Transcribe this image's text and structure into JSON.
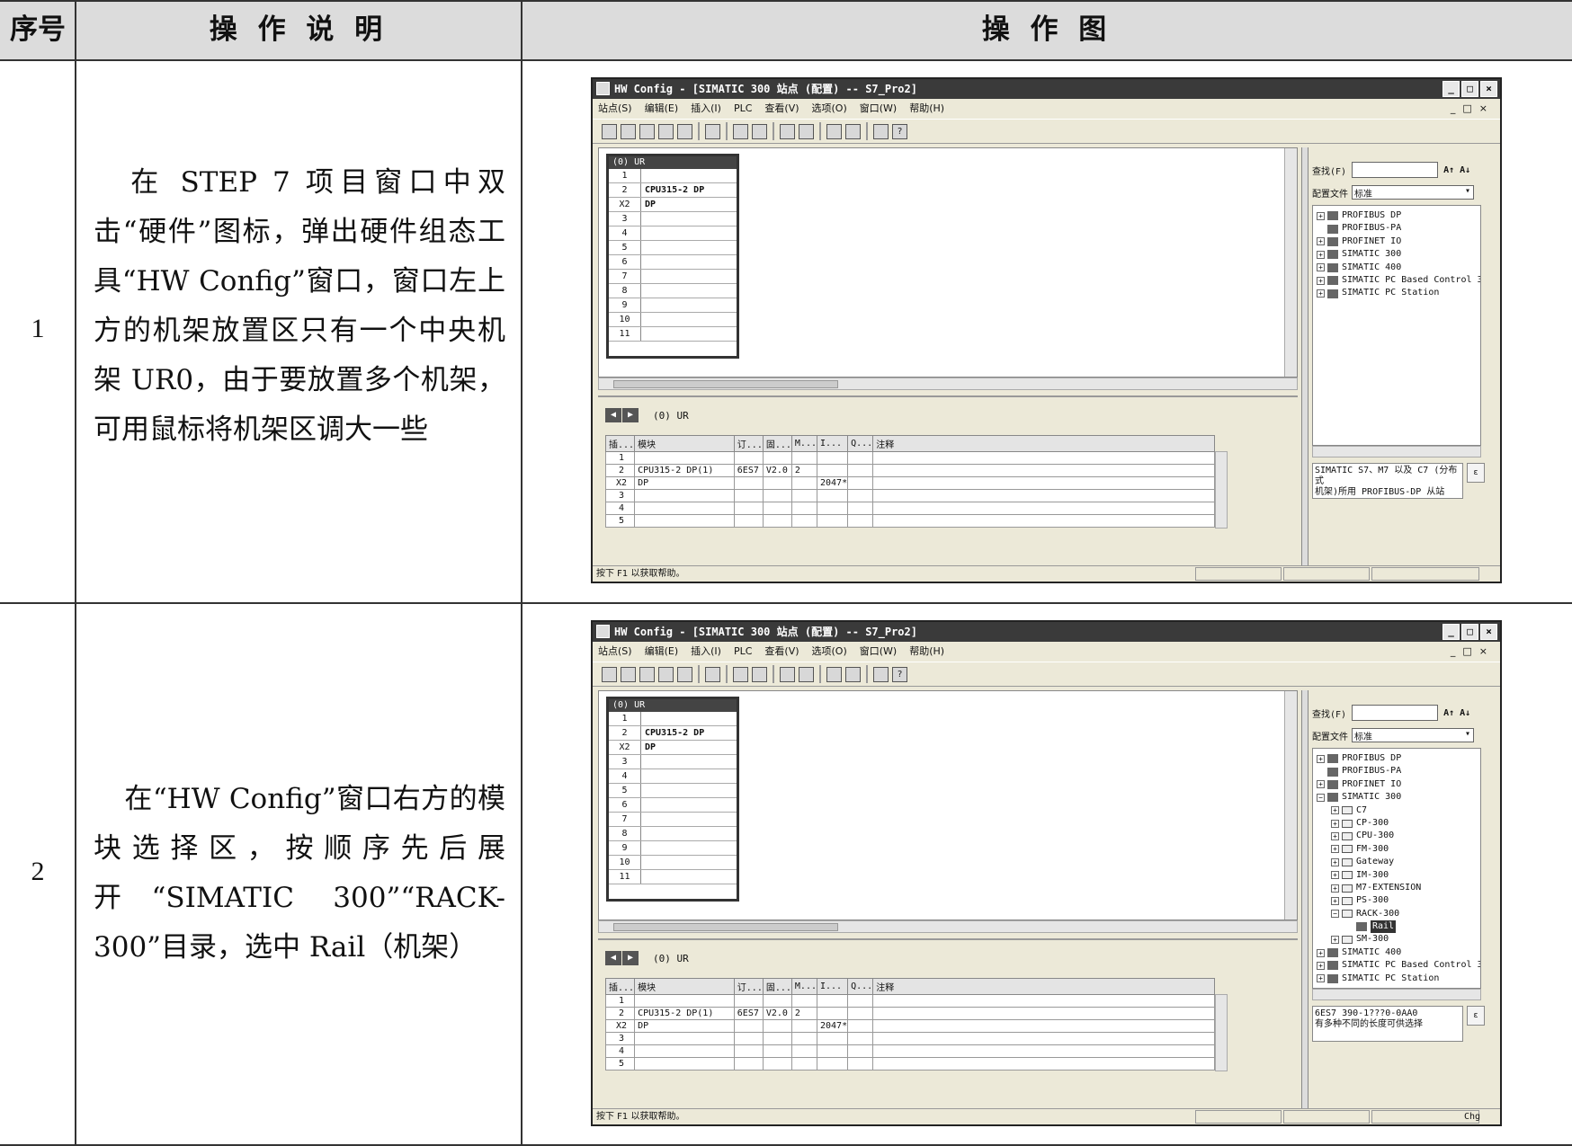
{
  "header": {
    "col_num": "序号",
    "col_desc": "操 作 说 明",
    "col_fig": "操 作 图"
  },
  "rows": [
    {
      "num": "1",
      "desc": "在 STEP 7 项目窗口中双击“硬件”图标，弹出硬件组态工具“HW Config”窗口，窗口左上方的机架放置区只有一个中央机架 UR0，由于要放置多个机架，可用鼠标将机架区调大一些",
      "win": {
        "title": "HW Config - [SIMATIC 300 站点 (配置) -- S7_Pro2]",
        "tree": [
          {
            "label": "PROFIBUS DP",
            "level": 0,
            "exp": "+"
          },
          {
            "label": "PROFIBUS-PA",
            "level": 0,
            "exp": ""
          },
          {
            "label": "PROFINET IO",
            "level": 0,
            "exp": "+"
          },
          {
            "label": "SIMATIC 300",
            "level": 0,
            "exp": "+"
          },
          {
            "label": "SIMATIC 400",
            "level": 0,
            "exp": "+"
          },
          {
            "label": "SIMATIC PC Based Control 300/400",
            "level": 0,
            "exp": "+"
          },
          {
            "label": "SIMATIC PC Station",
            "level": 0,
            "exp": "+"
          }
        ],
        "info": "SIMATIC S7、M7 以及 C7 (分布式\n机架)所用 PROFIBUS-DP 从站",
        "status_chg": ""
      }
    },
    {
      "num": "2",
      "desc": "在“HW Config”窗口右方的模块选择区，按顺序先后展开“SIMATIC 300”“RACK- 300”目录，选中 Rail（机架）",
      "win": {
        "title": "HW Config - [SIMATIC 300 站点 (配置) -- S7_Pro2]",
        "tree": [
          {
            "label": "PROFIBUS DP",
            "level": 0,
            "exp": "+"
          },
          {
            "label": "PROFIBUS-PA",
            "level": 0,
            "exp": ""
          },
          {
            "label": "PROFINET IO",
            "level": 0,
            "exp": "+"
          },
          {
            "label": "SIMATIC 300",
            "level": 0,
            "exp": "−"
          },
          {
            "label": "C7",
            "level": 1,
            "exp": "+"
          },
          {
            "label": "CP-300",
            "level": 1,
            "exp": "+"
          },
          {
            "label": "CPU-300",
            "level": 1,
            "exp": "+"
          },
          {
            "label": "FM-300",
            "level": 1,
            "exp": "+"
          },
          {
            "label": "Gateway",
            "level": 1,
            "exp": "+"
          },
          {
            "label": "IM-300",
            "level": 1,
            "exp": "+"
          },
          {
            "label": "M7-EXTENSION",
            "level": 1,
            "exp": "+"
          },
          {
            "label": "PS-300",
            "level": 1,
            "exp": "+"
          },
          {
            "label": "RACK-300",
            "level": 1,
            "exp": "−"
          },
          {
            "label": "Rail",
            "level": 2,
            "exp": "",
            "selected": true
          },
          {
            "label": "SM-300",
            "level": 1,
            "exp": "+"
          },
          {
            "label": "SIMATIC 400",
            "level": 0,
            "exp": "+"
          },
          {
            "label": "SIMATIC PC Based Control 300/400",
            "level": 0,
            "exp": "+"
          },
          {
            "label": "SIMATIC PC Station",
            "level": 0,
            "exp": "+"
          }
        ],
        "info": "6ES7 390-1???0-0AA0\n有多种不同的长度可供选择",
        "status_chg": "Chg"
      }
    }
  ],
  "hwconfig": {
    "menu": [
      "站点(S)",
      "编辑(E)",
      "插入(I)",
      "PLC",
      "查看(V)",
      "选项(O)",
      "窗口(W)",
      "帮助(H)"
    ],
    "rack_title": "(0) UR",
    "rack_rows": [
      {
        "slot": "1",
        "module": ""
      },
      {
        "slot": "2",
        "module": "CPU315-2 DP"
      },
      {
        "slot": "X2",
        "module": "DP"
      },
      {
        "slot": "3",
        "module": ""
      },
      {
        "slot": "4",
        "module": ""
      },
      {
        "slot": "5",
        "module": ""
      },
      {
        "slot": "6",
        "module": ""
      },
      {
        "slot": "7",
        "module": ""
      },
      {
        "slot": "8",
        "module": ""
      },
      {
        "slot": "9",
        "module": ""
      },
      {
        "slot": "10",
        "module": ""
      },
      {
        "slot": "11",
        "module": ""
      }
    ],
    "detail_label": "(0)   UR",
    "detail_headers": [
      "插...",
      "模块",
      "订...",
      "固...",
      "M...",
      "I...",
      "Q...",
      "注释"
    ],
    "detail_rows": [
      [
        "1",
        "",
        "",
        "",
        "",
        "",
        "",
        ""
      ],
      [
        "2",
        "CPU315-2 DP(1)",
        "6ES7",
        "V2.0",
        "2",
        "",
        "",
        ""
      ],
      [
        "X2",
        "DP",
        "",
        "",
        "",
        "2047*",
        "",
        ""
      ],
      [
        "3",
        "",
        "",
        "",
        "",
        "",
        "",
        ""
      ],
      [
        "4",
        "",
        "",
        "",
        "",
        "",
        "",
        ""
      ],
      [
        "5",
        "",
        "",
        "",
        "",
        "",
        "",
        ""
      ]
    ],
    "find_label": "查找(F)",
    "profile_label": "配置文件",
    "profile_value": "标准",
    "status_text": "按下 F1 以获取帮助。"
  }
}
